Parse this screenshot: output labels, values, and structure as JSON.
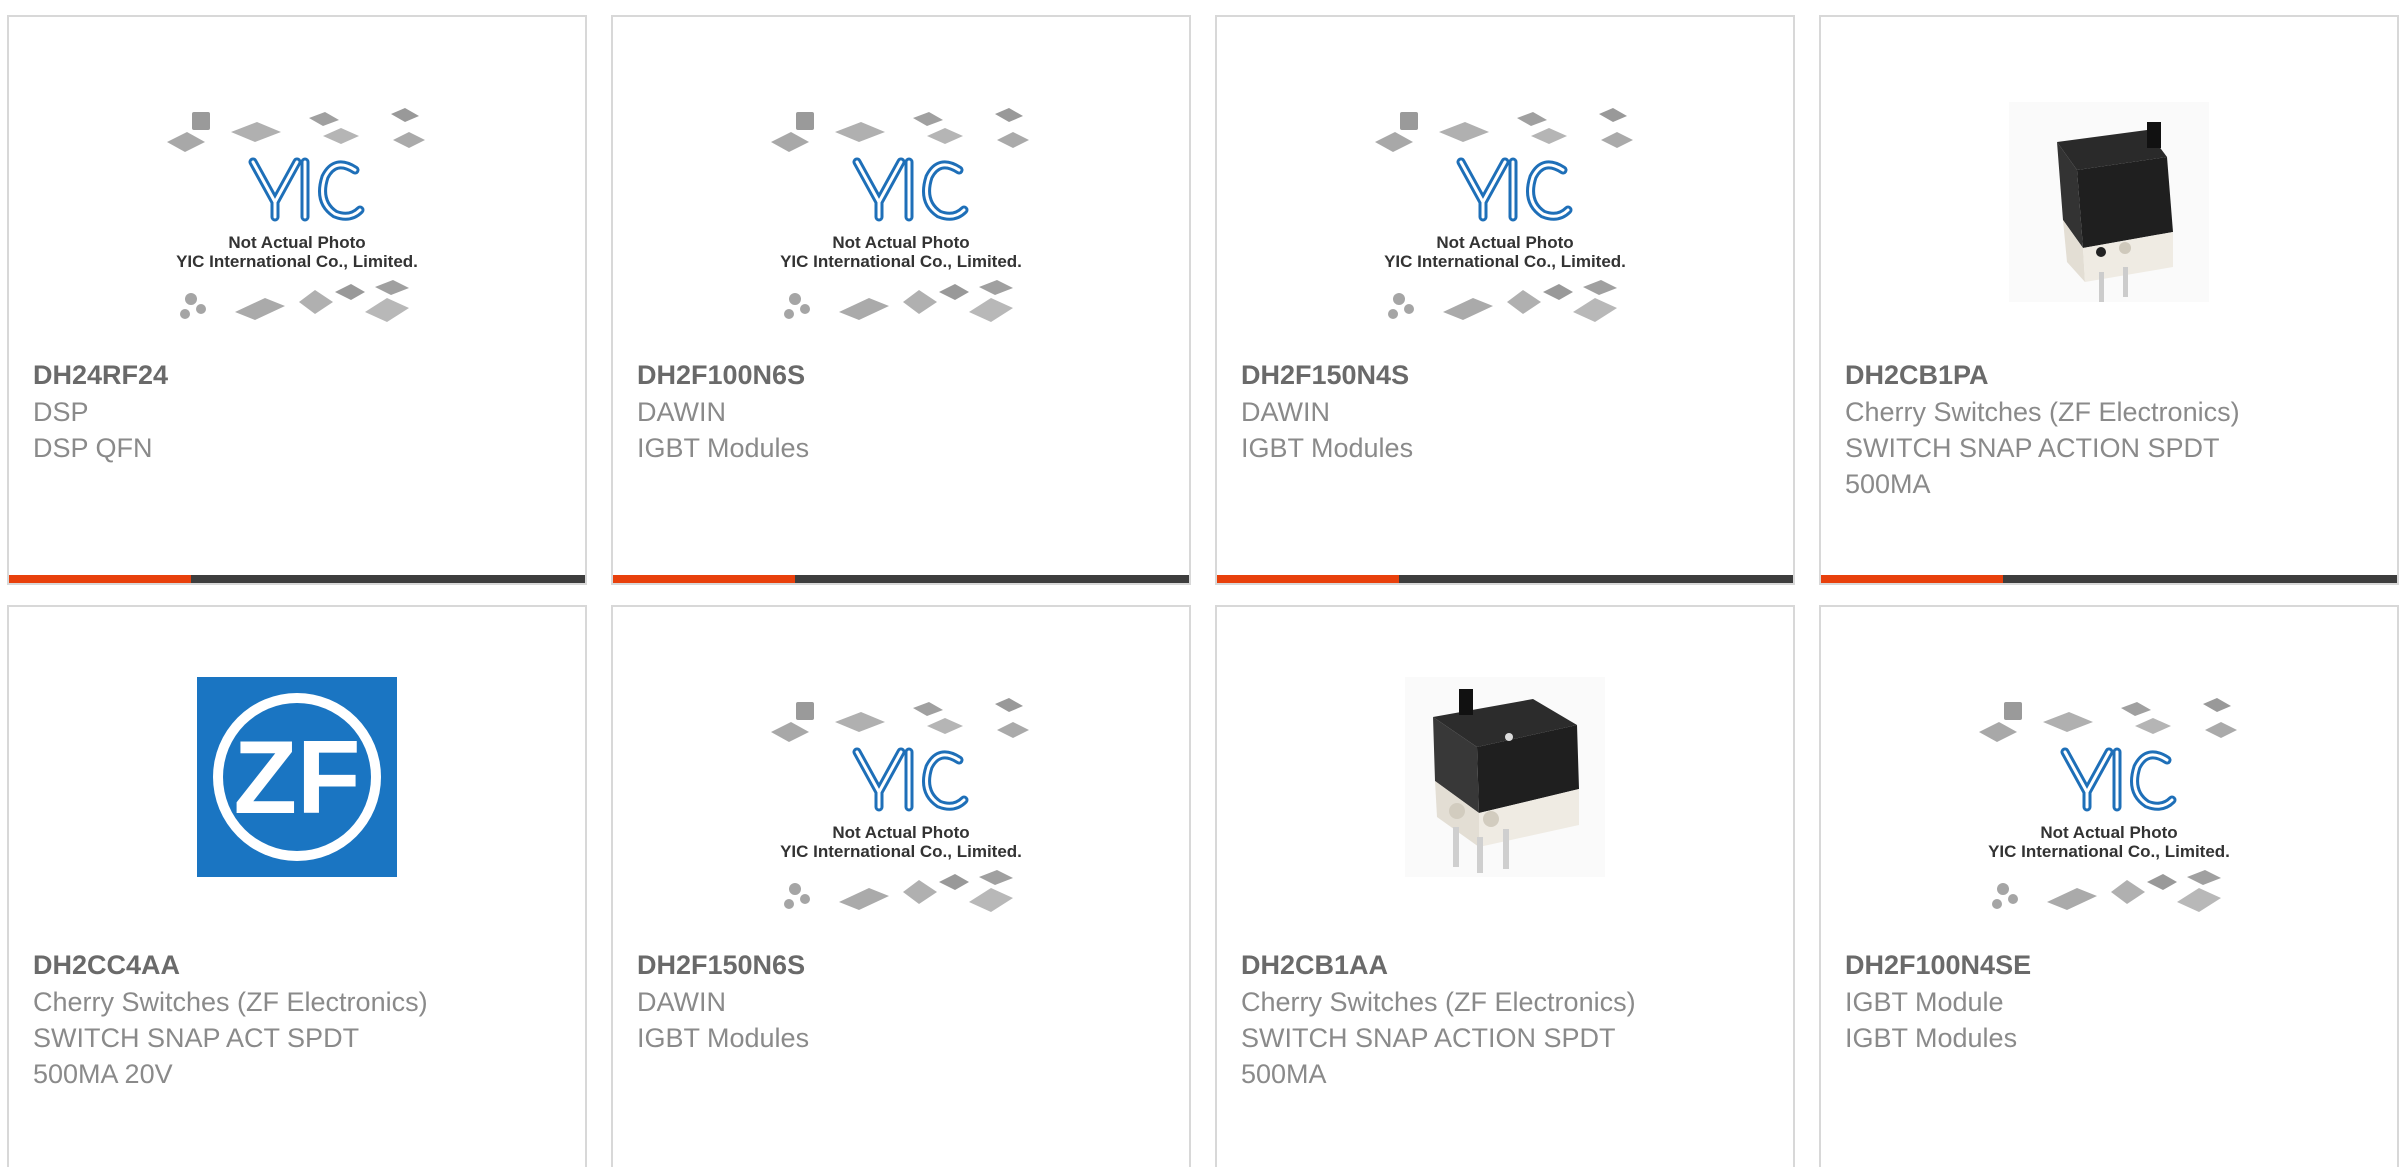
{
  "products": [
    {
      "part_number": "DH24RF24",
      "line1": "DSP",
      "line2": "DSP QFN",
      "image": "yic-placeholder",
      "placeholder_caption": [
        "Not Actual Photo",
        "YIC International Co., Limited."
      ]
    },
    {
      "part_number": "DH2F100N6S",
      "line1": "DAWIN",
      "line2": "IGBT Modules",
      "image": "yic-placeholder",
      "placeholder_caption": [
        "Not Actual Photo",
        "YIC International Co., Limited."
      ]
    },
    {
      "part_number": "DH2F150N4S",
      "line1": "DAWIN",
      "line2": "IGBT Modules",
      "image": "yic-placeholder",
      "placeholder_caption": [
        "Not Actual Photo",
        "YIC International Co., Limited."
      ]
    },
    {
      "part_number": "DH2CB1PA",
      "line1": "Cherry Switches (ZF Electronics)",
      "line2": "SWITCH SNAP ACTION SPDT",
      "line3": "500MA",
      "image": "snap-switch-photo"
    },
    {
      "part_number": "DH2CC4AA",
      "line1": "Cherry Switches (ZF Electronics)",
      "line2": "SWITCH SNAP ACT SPDT",
      "line3": "500MA 20V",
      "image": "zf-logo",
      "logo_text": "ZF"
    },
    {
      "part_number": "DH2F150N6S",
      "line1": "DAWIN",
      "line2": "IGBT Modules",
      "image": "yic-placeholder",
      "placeholder_caption": [
        "Not Actual Photo",
        "YIC International Co., Limited."
      ]
    },
    {
      "part_number": "DH2CB1AA",
      "line1": "Cherry Switches (ZF Electronics)",
      "line2": "SWITCH SNAP ACTION SPDT",
      "line3": "500MA",
      "image": "snap-switch-photo"
    },
    {
      "part_number": "DH2F100N4SE",
      "line1": "IGBT Module",
      "line2": "IGBT Modules",
      "image": "yic-placeholder",
      "placeholder_caption": [
        "Not Actual Photo",
        "YIC International Co., Limited."
      ]
    }
  ],
  "colors": {
    "accent": "#e8400c",
    "bar": "#3d3d3d",
    "border": "#d8d8d8",
    "zf_blue": "#1a75c2"
  }
}
